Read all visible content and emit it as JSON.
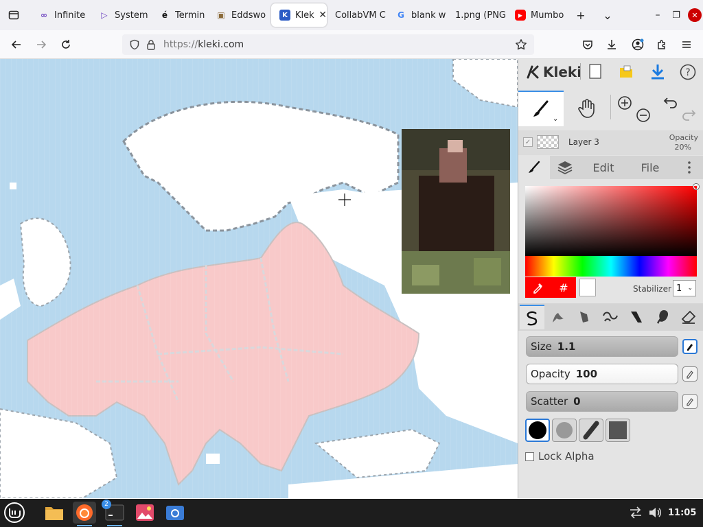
{
  "browser": {
    "tabs": [
      {
        "label": "Infinite",
        "icon": "infinity-icon",
        "glyph": "∞",
        "color": "#6a3fbf"
      },
      {
        "label": "System",
        "icon": "play-icon",
        "glyph": "▷",
        "color": "#6a3fbf"
      },
      {
        "label": "Termin",
        "icon": "e-acute-icon",
        "glyph": "é",
        "color": "#111111"
      },
      {
        "label": "Eddswo",
        "icon": "photo-icon",
        "glyph": "▣",
        "color": "#8a6a3a"
      },
      {
        "label": "Kleki",
        "icon": "kleki-favicon-icon",
        "glyph": "K",
        "color": "#2c5cc5",
        "active": true
      },
      {
        "label": "CollabVM C",
        "icon": "none",
        "glyph": "",
        "color": "#333333"
      },
      {
        "label": "blank w",
        "icon": "google-icon",
        "glyph": "G",
        "color": "#4285f4"
      },
      {
        "label": "1.png (PNG",
        "icon": "none",
        "glyph": "",
        "color": "#333333"
      },
      {
        "label": "Mumbo",
        "icon": "youtube-icon",
        "glyph": "▶",
        "color": "#ff0000"
      }
    ],
    "url_protocol": "https://",
    "url_host": "kleki.com",
    "window_controls": {
      "minimize": "–",
      "maximize": "❐",
      "close": "✕"
    },
    "new_tab": "+",
    "list_all_tabs": "⌄"
  },
  "kleki": {
    "logo": "Kleki",
    "layer": {
      "name": "Layer 3",
      "opacity_label": "Opacity",
      "opacity_value": "20%"
    },
    "tabs": {
      "edit": "Edit",
      "file": "File"
    },
    "color": {
      "primary": "#ff0000",
      "secondary": "#ffffff",
      "hex_symbol": "#"
    },
    "stabilizer": {
      "label": "Stabilizer",
      "value": "1"
    },
    "brush": {
      "size_label": "Size",
      "size_value": "1.1",
      "opacity_label": "Opacity",
      "opacity_value": "100",
      "scatter_label": "Scatter",
      "scatter_value": "0"
    },
    "lock_alpha": "Lock Alpha"
  },
  "taskbar": {
    "terminal_badge": "2",
    "clock": "11:05"
  }
}
